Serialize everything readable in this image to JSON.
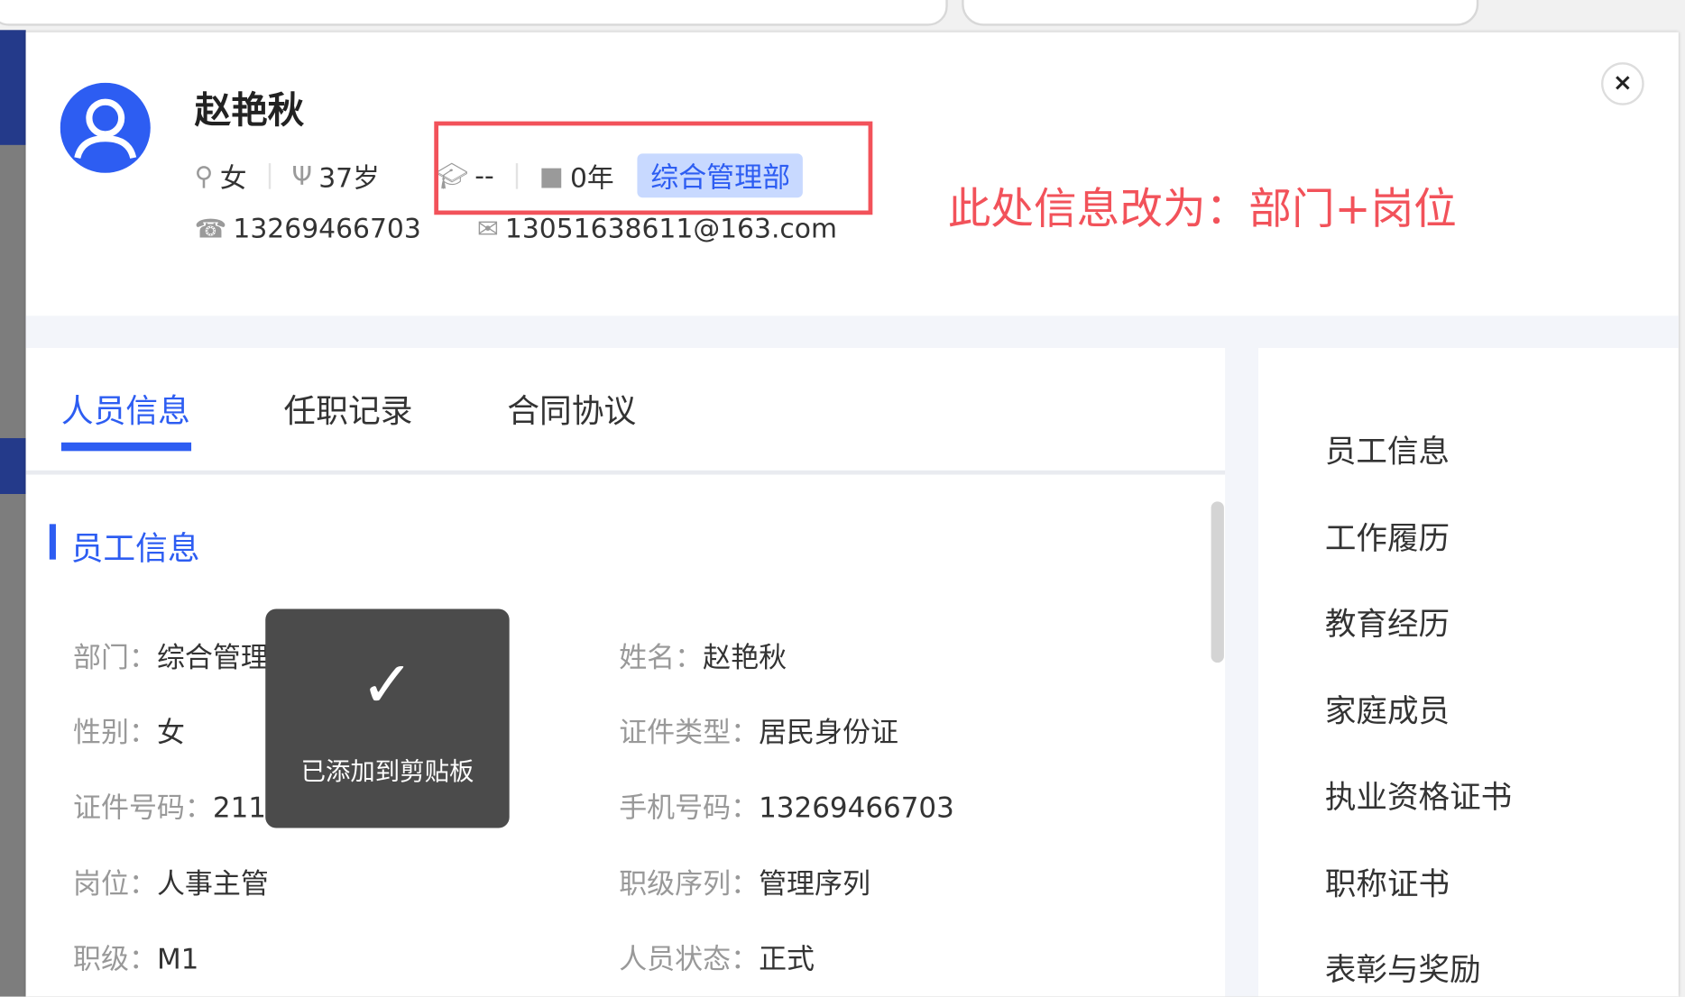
{
  "header": {
    "name": "赵艳秋",
    "gender": "女",
    "age": "37岁",
    "education": "--",
    "tenure": "0年",
    "department": "综合管理部",
    "phone": "13269466703",
    "email": "13051638611@163.com"
  },
  "annotation": "此处信息改为：部门+岗位",
  "close_label": "×",
  "tabs": [
    {
      "label": "人员信息"
    },
    {
      "label": "任职记录"
    },
    {
      "label": "合同协议"
    }
  ],
  "section_title": "员工信息",
  "fields": [
    {
      "label": "部门：",
      "value": "综合管理部"
    },
    {
      "label": "姓名：",
      "value": "赵艳秋"
    },
    {
      "label": "性别：",
      "value": "女"
    },
    {
      "label": "证件类型：",
      "value": "居民身份证"
    },
    {
      "label": "证件号码：",
      "value": "211"
    },
    {
      "label": "手机号码：",
      "value": "13269466703"
    },
    {
      "label": "岗位：",
      "value": "人事主管"
    },
    {
      "label": "职级序列：",
      "value": "管理序列"
    },
    {
      "label": "职级：",
      "value": "M1"
    },
    {
      "label": "人员状态：",
      "value": "正式"
    }
  ],
  "side_nav": [
    {
      "label": "员工信息"
    },
    {
      "label": "工作履历"
    },
    {
      "label": "教育经历"
    },
    {
      "label": "家庭成员"
    },
    {
      "label": "执业资格证书"
    },
    {
      "label": "职称证书"
    },
    {
      "label": "表彰与奖励"
    }
  ],
  "toast": {
    "message": "已添加到剪贴板"
  },
  "colors": {
    "accent": "#2d5df2",
    "annotation": "#f2525a",
    "toast_bg": "#4b4b4b"
  }
}
